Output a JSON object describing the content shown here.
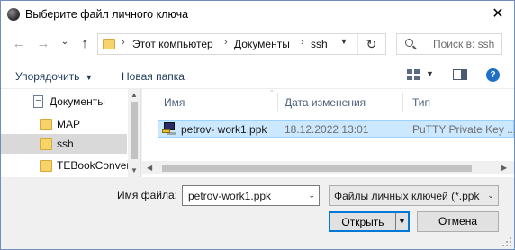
{
  "window": {
    "title": "Выберите файл личного ключа",
    "close_glyph": "✕"
  },
  "nav": {
    "back_glyph": "←",
    "forward_glyph": "→",
    "recent_glyph": "⌄",
    "up_glyph": "↑",
    "breadcrumb": [
      "Этот компьютер",
      "Документы",
      "ssh"
    ],
    "crumb_sep": "›",
    "refresh_glyph": "↻",
    "search_placeholder": "Поиск в: ssh"
  },
  "toolbar": {
    "organize_label": "Упорядочить",
    "new_folder_label": "Новая папка",
    "help_label": "?"
  },
  "tree": {
    "items": [
      {
        "label": "Документы",
        "icon": "documents-icon"
      },
      {
        "label": "MAP",
        "icon": "folder-icon"
      },
      {
        "label": "ssh",
        "icon": "folder-icon",
        "selected": true
      },
      {
        "label": "TEBookConver",
        "icon": "folder-icon"
      }
    ]
  },
  "files": {
    "columns": [
      "Имя",
      "Дата изменения",
      "Тип"
    ],
    "rows": [
      {
        "name": "petrov- work1.ppk",
        "modified": "18.12.2022 13:01",
        "type": "PuTTY Private Key ...",
        "icon": "putty-key-icon",
        "selected": true
      }
    ]
  },
  "footer": {
    "filename_label": "Имя файла:",
    "filename_value": "petrov-work1.ppk",
    "filetype_value": "Файлы личных ключей (*.ppk",
    "open_label": "Открыть",
    "cancel_label": "Отмена"
  },
  "colors": {
    "accent": "#0078d7",
    "selection_bg": "#cce8ff",
    "selection_border": "#99d1ff",
    "link_text": "#1e395b",
    "help_icon": "#1f6fc7"
  }
}
